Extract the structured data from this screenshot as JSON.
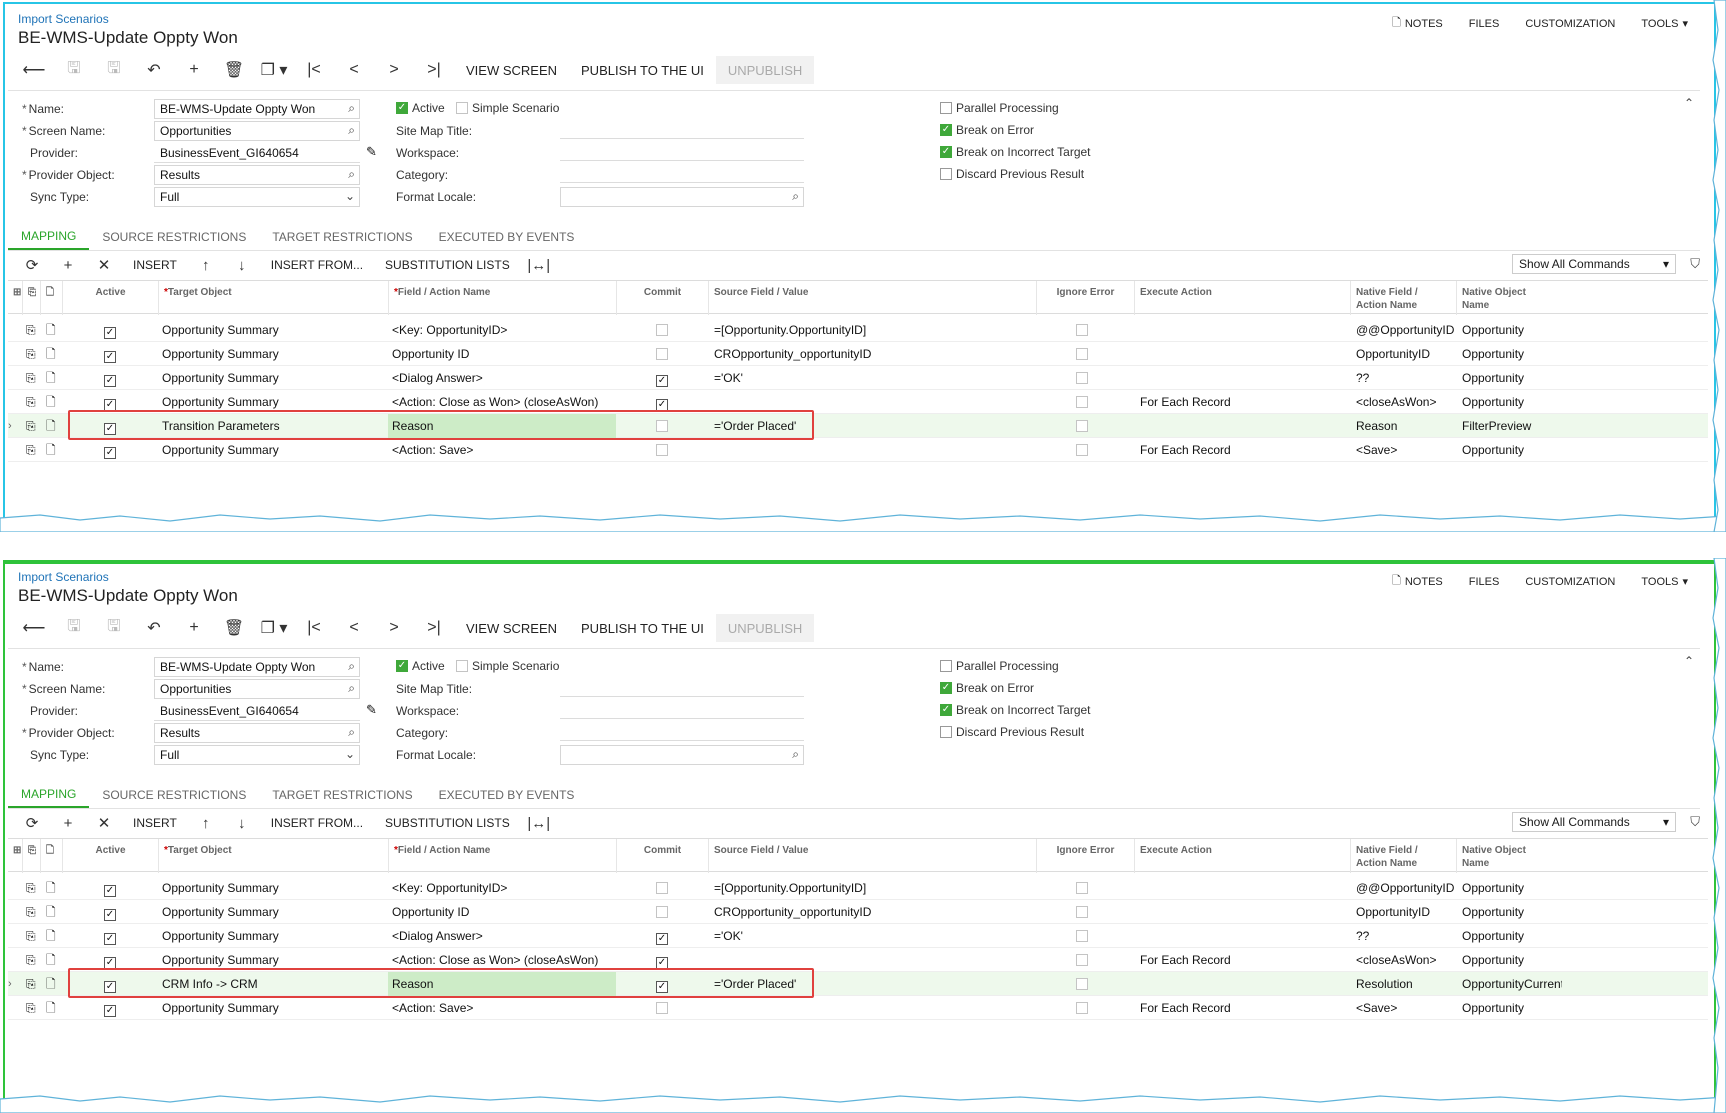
{
  "panels": [
    {
      "breadcrumb": "Import Scenarios",
      "title": "BE-WMS-Update Oppty Won",
      "topbar": {
        "notes": "NOTES",
        "files": "FILES",
        "customization": "CUSTOMIZATION",
        "tools": "TOOLS"
      },
      "toolbar": {
        "view_screen": "VIEW SCREEN",
        "publish": "PUBLISH TO THE UI",
        "unpublish": "UNPUBLISH"
      },
      "form": {
        "name_label": "Name:",
        "name_value": "BE-WMS-Update Oppty Won",
        "screen_label": "Screen Name:",
        "screen_value": "Opportunities",
        "provider_label": "Provider:",
        "provider_value": "BusinessEvent_GI640654",
        "provider_object_label": "Provider Object:",
        "provider_object_value": "Results",
        "sync_label": "Sync Type:",
        "sync_value": "Full",
        "active_label": "Active",
        "simple_label": "Simple Scenario",
        "sitemap_label": "Site Map Title:",
        "workspace_label": "Workspace:",
        "category_label": "Category:",
        "locale_label": "Format Locale:",
        "parallel_label": "Parallel Processing",
        "break_error_label": "Break on Error",
        "break_target_label": "Break on Incorrect Target",
        "discard_label": "Discard Previous Result"
      },
      "tabs": [
        "MAPPING",
        "SOURCE RESTRICTIONS",
        "TARGET RESTRICTIONS",
        "EXECUTED BY EVENTS"
      ],
      "gridbar": {
        "insert": "INSERT",
        "insert_from": "INSERT FROM...",
        "substitution": "SUBSTITUTION LISTS",
        "commands": "Show All Commands"
      },
      "columns": {
        "active": "Active",
        "target": "Target Object",
        "field": "Field / Action Name",
        "commit": "Commit",
        "source": "Source Field / Value",
        "ignore": "Ignore Error",
        "execute": "Execute Action",
        "native_field": "Native Field / Action Name",
        "native_object": "Native Object Name"
      },
      "rows": [
        {
          "target": "Opportunity Summary",
          "field": "<Key: OpportunityID>",
          "commit": false,
          "source": "=[Opportunity.OpportunityID]",
          "execute": "",
          "native_field": "@@OpportunityID",
          "native_object": "Opportunity"
        },
        {
          "target": "Opportunity Summary",
          "field": "Opportunity ID",
          "commit": false,
          "source": "CROpportunity_opportunityID",
          "execute": "",
          "native_field": "OpportunityID",
          "native_object": "Opportunity"
        },
        {
          "target": "Opportunity Summary",
          "field": "<Dialog Answer>",
          "commit": true,
          "source": "='OK'",
          "execute": "",
          "native_field": "??",
          "native_object": "Opportunity"
        },
        {
          "target": "Opportunity Summary",
          "field": "<Action: Close as Won> (closeAsWon)",
          "commit": true,
          "source": "",
          "execute": "For Each Record",
          "native_field": "<closeAsWon>",
          "native_object": "Opportunity"
        },
        {
          "target": "Transition Parameters",
          "field": "Reason",
          "commit": false,
          "source": "='Order Placed'",
          "execute": "",
          "native_field": "Reason",
          "native_object": "FilterPreview"
        },
        {
          "target": "Opportunity Summary",
          "field": "<Action: Save>",
          "commit": false,
          "source": "",
          "execute": "For Each Record",
          "native_field": "<Save>",
          "native_object": "Opportunity"
        }
      ]
    },
    {
      "breadcrumb": "Import Scenarios",
      "title": "BE-WMS-Update Oppty Won",
      "topbar": {
        "notes": "NOTES",
        "files": "FILES",
        "customization": "CUSTOMIZATION",
        "tools": "TOOLS"
      },
      "toolbar": {
        "view_screen": "VIEW SCREEN",
        "publish": "PUBLISH TO THE UI",
        "unpublish": "UNPUBLISH"
      },
      "form": {
        "name_label": "Name:",
        "name_value": "BE-WMS-Update Oppty Won",
        "screen_label": "Screen Name:",
        "screen_value": "Opportunities",
        "provider_label": "Provider:",
        "provider_value": "BusinessEvent_GI640654",
        "provider_object_label": "Provider Object:",
        "provider_object_value": "Results",
        "sync_label": "Sync Type:",
        "sync_value": "Full",
        "active_label": "Active",
        "simple_label": "Simple Scenario",
        "sitemap_label": "Site Map Title:",
        "workspace_label": "Workspace:",
        "category_label": "Category:",
        "locale_label": "Format Locale:",
        "parallel_label": "Parallel Processing",
        "break_error_label": "Break on Error",
        "break_target_label": "Break on Incorrect Target",
        "discard_label": "Discard Previous Result"
      },
      "tabs": [
        "MAPPING",
        "SOURCE RESTRICTIONS",
        "TARGET RESTRICTIONS",
        "EXECUTED BY EVENTS"
      ],
      "gridbar": {
        "insert": "INSERT",
        "insert_from": "INSERT FROM...",
        "substitution": "SUBSTITUTION LISTS",
        "commands": "Show All Commands"
      },
      "columns": {
        "active": "Active",
        "target": "Target Object",
        "field": "Field / Action Name",
        "commit": "Commit",
        "source": "Source Field / Value",
        "ignore": "Ignore Error",
        "execute": "Execute Action",
        "native_field": "Native Field / Action Name",
        "native_object": "Native Object Name"
      },
      "rows": [
        {
          "target": "Opportunity Summary",
          "field": "<Key: OpportunityID>",
          "commit": false,
          "source": "=[Opportunity.OpportunityID]",
          "execute": "",
          "native_field": "@@OpportunityID",
          "native_object": "Opportunity"
        },
        {
          "target": "Opportunity Summary",
          "field": "Opportunity ID",
          "commit": false,
          "source": "CROpportunity_opportunityID",
          "execute": "",
          "native_field": "OpportunityID",
          "native_object": "Opportunity"
        },
        {
          "target": "Opportunity Summary",
          "field": "<Dialog Answer>",
          "commit": true,
          "source": "='OK'",
          "execute": "",
          "native_field": "??",
          "native_object": "Opportunity"
        },
        {
          "target": "Opportunity Summary",
          "field": "<Action: Close as Won> (closeAsWon)",
          "commit": true,
          "source": "",
          "execute": "For Each Record",
          "native_field": "<closeAsWon>",
          "native_object": "Opportunity"
        },
        {
          "target": "CRM Info -> CRM",
          "field": "Reason",
          "commit": true,
          "source": "='Order Placed'",
          "execute": "",
          "native_field": "Resolution",
          "native_object": "OpportunityCurrent"
        },
        {
          "target": "Opportunity Summary",
          "field": "<Action: Save>",
          "commit": false,
          "source": "",
          "execute": "For Each Record",
          "native_field": "<Save>",
          "native_object": "Opportunity"
        }
      ]
    }
  ],
  "icons": {
    "back": "arrow-left-icon",
    "save": "save-icon",
    "undo": "undo-icon",
    "add": "plus-icon",
    "delete": "trash-icon",
    "copy": "copy-icon",
    "first": "first-record-icon",
    "prev": "prev-icon",
    "next": "next-icon",
    "last": "last-record-icon",
    "refresh": "refresh-icon",
    "remove": "close-icon",
    "up": "arrow-up-icon",
    "down": "arrow-down-icon",
    "fit": "fit-columns-icon",
    "filter": "filter-icon",
    "lookup": "search-icon",
    "edit": "pencil-icon",
    "notes": "note-icon"
  },
  "colors": {
    "breadcrumb": "#1f73b7",
    "active_tab": "#2aa52a",
    "highlight_box": "#e0413e",
    "selected_row": "#eef9ec",
    "top_frame": "#27c5e6",
    "bottom_frame": "#2ec33a"
  }
}
